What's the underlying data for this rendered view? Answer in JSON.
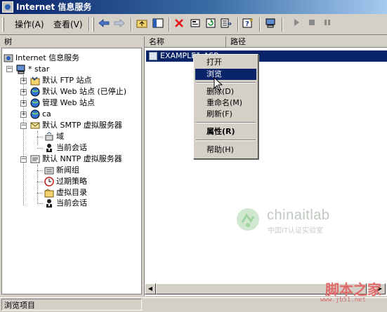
{
  "window": {
    "title": "Internet 信息服务"
  },
  "menubar": {
    "action": "操作(A)",
    "view": "查看(V)"
  },
  "toolbar": {
    "icons": [
      "back-arrow-icon",
      "forward-arrow-icon",
      "up-folder-icon",
      "show-tree-icon",
      "delete-icon",
      "properties-icon",
      "refresh-icon",
      "export-list-icon",
      "help-icon",
      "computer-icon",
      "play-icon",
      "stop-icon",
      "pause-icon"
    ]
  },
  "tree": {
    "header": "树",
    "root": "Internet 信息服务",
    "server": "* star",
    "items": {
      "ftp": "默认 FTP 站点",
      "web": "默认 Web 站点 (已停止)",
      "admin_web": "管理 Web 站点",
      "ca": "ca",
      "smtp": "默认 SMTP 虚拟服务器",
      "smtp_domain": "域",
      "smtp_sessions": "当前会话",
      "nntp": "默认 NNTP 虚拟服务器",
      "nntp_newsgroups": "新闻组",
      "nntp_expiration": "过期策略",
      "nntp_vdirs": "虚拟目录",
      "nntp_sessions": "当前会话"
    }
  },
  "list": {
    "col_name": "名称",
    "col_path": "路径",
    "selected_item": "EXAMPLE1.ASP"
  },
  "context_menu": {
    "open": "打开",
    "browse": "浏览",
    "delete": "删除(D)",
    "rename": "重命名(M)",
    "refresh": "刷新(F)",
    "properties": "属性(R)",
    "help": "帮助(H)"
  },
  "statusbar": {
    "text": "浏览项目"
  },
  "watermarks": {
    "logo_text": "chinaitlab",
    "logo_sub": "中国IT认证实验室",
    "jb_text": "脚本之家",
    "jb_url": "www.jb51.net"
  },
  "colors": {
    "titlebar_start": "#0a246a",
    "selection": "#0a246a",
    "face": "#d4d0c8"
  }
}
